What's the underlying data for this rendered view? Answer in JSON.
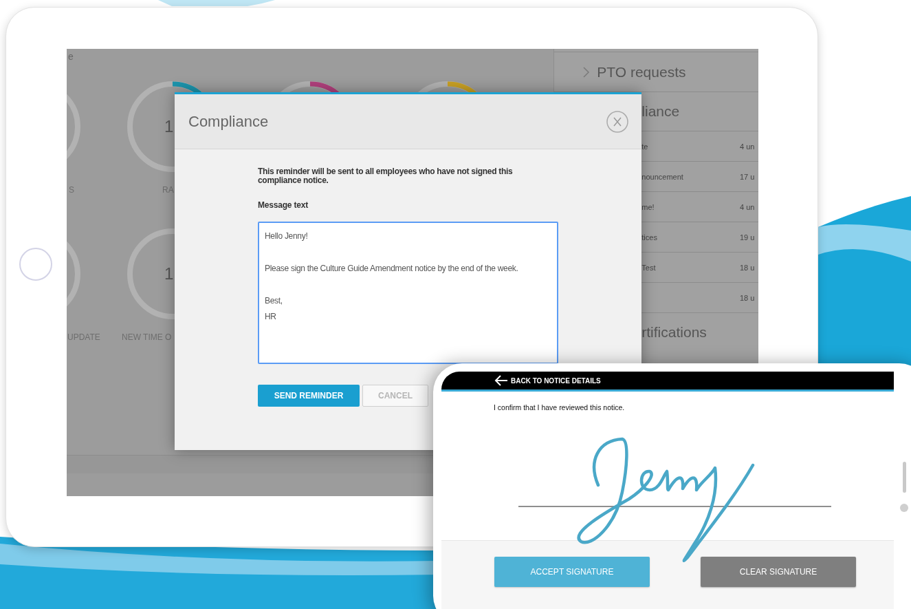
{
  "tablet": {
    "screen": {
      "corner_text": "e",
      "gauge_rows": [
        [
          {
            "label": "S"
          },
          {
            "number": "1",
            "label": "RA",
            "color": "#1c94ac"
          },
          {
            "color": "#b0407c"
          },
          {
            "color": "#c8a024"
          }
        ],
        [
          {
            "label": "UPDATE"
          },
          {
            "number": "1",
            "label": "NEW TIME O"
          }
        ]
      ],
      "side_panel": {
        "sections": [
          {
            "title": "PTO requests",
            "kind": "collapsed"
          },
          {
            "title": "liance",
            "kind": "open",
            "rows": [
              {
                "name": "te",
                "count": "4 un"
              },
              {
                "name": "nouncement",
                "count": "17 u"
              },
              {
                "name": "me!",
                "count": "4 un"
              },
              {
                "name": "tices",
                "count": "19 u"
              },
              {
                "name": "Test",
                "count": "18 u"
              },
              {
                "name": "",
                "count": "18 u"
              }
            ]
          },
          {
            "title": "rtifications",
            "kind": "open"
          }
        ]
      }
    },
    "modal": {
      "title": "Compliance",
      "notice": "This reminder will be sent to all employees who have not signed this compliance notice.",
      "message_label": "Message text",
      "message": {
        "value": "Hello Jenny!\n\nPlease sign the Culture Guide Amendment notice by the end of the week.\n\nBest,\nHR"
      },
      "buttons": [
        {
          "label": "SEND REMINDER",
          "kind": "primary"
        },
        {
          "label": "CANCEL",
          "kind": "secondary"
        }
      ]
    }
  },
  "phone": {
    "back_link": "BACK TO NOTICE DETAILS",
    "confirmation": "I confirm that I have reviewed this notice.",
    "buttons": [
      {
        "label": "ACCEPT SIGNATURE",
        "kind": "accept"
      },
      {
        "label": "CLEAR SIGNATURE",
        "kind": "clear"
      }
    ]
  }
}
